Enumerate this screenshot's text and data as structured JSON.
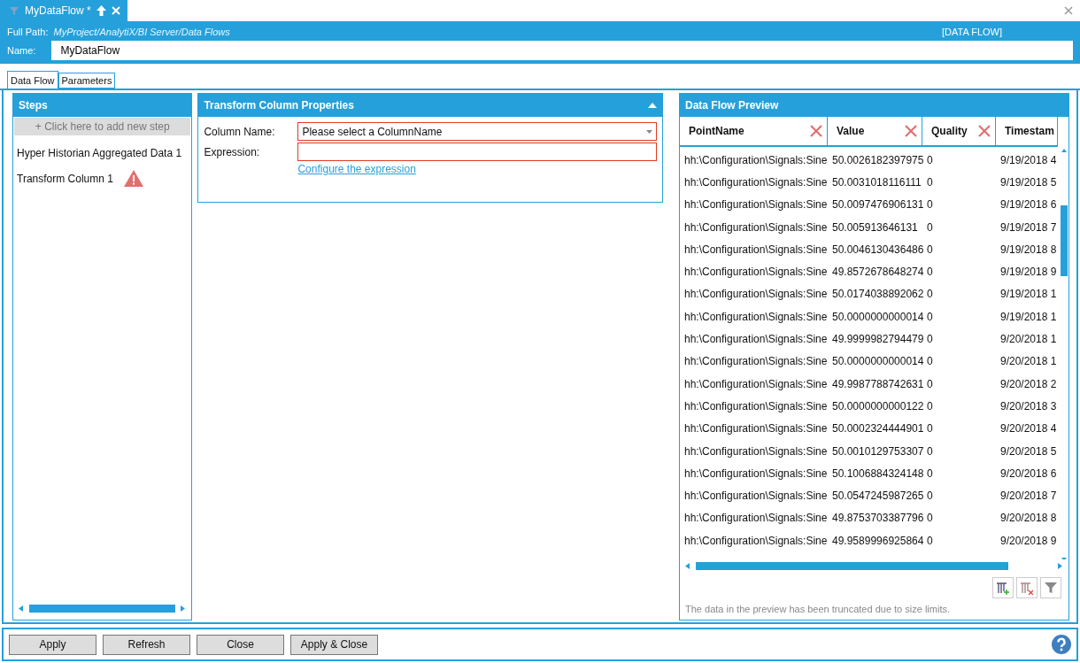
{
  "document_tab": {
    "title": "MyDataFlow *"
  },
  "header": {
    "full_path_label": "Full Path:",
    "full_path": "MyProject/AnalytiX/BI Server/Data Flows",
    "type": "[DATA FLOW]",
    "name_label": "Name:",
    "name_value": "MyDataFlow"
  },
  "tabs": [
    {
      "label": "Data Flow",
      "selected": true
    },
    {
      "label": "Parameters",
      "selected": false
    }
  ],
  "steps": {
    "title": "Steps",
    "add_label": "+  Click here to add new step",
    "items": [
      {
        "label": "Hyper Historian Aggregated Data  1",
        "warning": false
      },
      {
        "label": "Transform Column  1",
        "warning": true
      }
    ]
  },
  "properties": {
    "title": "Transform Column Properties",
    "column_name_label": "Column Name:",
    "column_name_placeholder": "Please select a ColumnName",
    "expression_label": "Expression:",
    "link": "Configure the expression"
  },
  "preview": {
    "title": "Data Flow Preview",
    "columns": [
      "PointName",
      "Value",
      "Quality",
      "Timestam"
    ],
    "rows": [
      [
        "hh:\\Configuration\\Signals:Sine",
        "50.0026182397975",
        "0",
        "9/19/2018 4"
      ],
      [
        "hh:\\Configuration\\Signals:Sine",
        "50.0031018116111",
        "0",
        "9/19/2018 5"
      ],
      [
        "hh:\\Configuration\\Signals:Sine",
        "50.0097476906131",
        "0",
        "9/19/2018 6"
      ],
      [
        "hh:\\Configuration\\Signals:Sine",
        "50.005913646131",
        "0",
        "9/19/2018 7"
      ],
      [
        "hh:\\Configuration\\Signals:Sine",
        "50.0046130436486",
        "0",
        "9/19/2018 8"
      ],
      [
        "hh:\\Configuration\\Signals:Sine",
        "49.8572678648274",
        "0",
        "9/19/2018 9"
      ],
      [
        "hh:\\Configuration\\Signals:Sine",
        "50.0174038892062",
        "0",
        "9/19/2018 1"
      ],
      [
        "hh:\\Configuration\\Signals:Sine",
        "50.0000000000014",
        "0",
        "9/19/2018 1"
      ],
      [
        "hh:\\Configuration\\Signals:Sine",
        "49.9999982794479",
        "0",
        "9/20/2018 1"
      ],
      [
        "hh:\\Configuration\\Signals:Sine",
        "50.0000000000014",
        "0",
        "9/20/2018 1"
      ],
      [
        "hh:\\Configuration\\Signals:Sine",
        "49.9987788742631",
        "0",
        "9/20/2018 2"
      ],
      [
        "hh:\\Configuration\\Signals:Sine",
        "50.0000000000122",
        "0",
        "9/20/2018 3"
      ],
      [
        "hh:\\Configuration\\Signals:Sine",
        "50.0002324444901",
        "0",
        "9/20/2018 4"
      ],
      [
        "hh:\\Configuration\\Signals:Sine",
        "50.0010129753307",
        "0",
        "9/20/2018 5"
      ],
      [
        "hh:\\Configuration\\Signals:Sine",
        "50.1006884324148",
        "0",
        "9/20/2018 6"
      ],
      [
        "hh:\\Configuration\\Signals:Sine",
        "50.0547245987265",
        "0",
        "9/20/2018 7"
      ],
      [
        "hh:\\Configuration\\Signals:Sine",
        "49.8753703387796",
        "0",
        "9/20/2018 8"
      ],
      [
        "hh:\\Configuration\\Signals:Sine",
        "49.9589996925864",
        "0",
        "9/20/2018 9"
      ]
    ],
    "note": "The data in the preview has been truncated due to size limits."
  },
  "buttons": [
    "Apply",
    "Refresh",
    "Close",
    "Apply & Close"
  ]
}
